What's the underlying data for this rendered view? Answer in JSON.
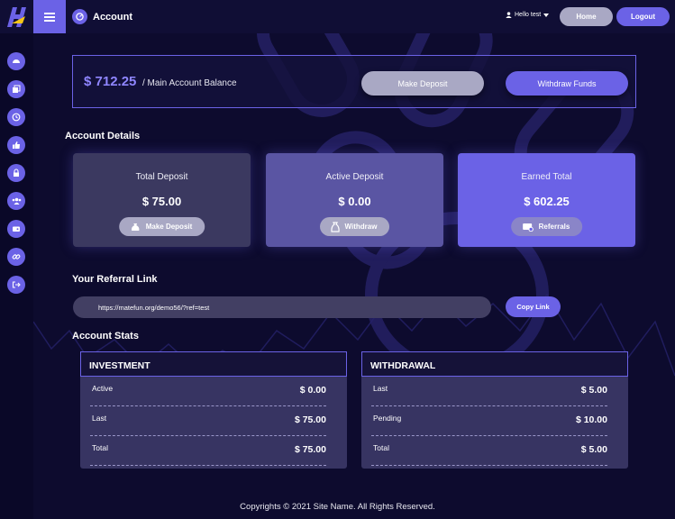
{
  "header": {
    "page_title": "Account",
    "user_greeting": "Hello test",
    "home_label": "Home",
    "logout_label": "Logout"
  },
  "sidebar": {
    "items": [
      {
        "icon": "dashboard-icon"
      },
      {
        "icon": "deposit-icon"
      },
      {
        "icon": "history-icon"
      },
      {
        "icon": "thumbs-up-icon"
      },
      {
        "icon": "lock-icon"
      },
      {
        "icon": "users-icon"
      },
      {
        "icon": "wallet-icon"
      },
      {
        "icon": "link-icon"
      },
      {
        "icon": "logout-icon"
      }
    ]
  },
  "balance": {
    "amount": "$ 712.25",
    "label": "/ Main Account Balance",
    "deposit_label": "Make Deposit",
    "withdraw_label": "Withdraw Funds"
  },
  "account_details": {
    "title": "Account Details",
    "cards": [
      {
        "label": "Total Deposit",
        "value": "$ 75.00",
        "button": "Make Deposit"
      },
      {
        "label": "Active Deposit",
        "value": "$ 0.00",
        "button": "Withdraw"
      },
      {
        "label": "Earned Total",
        "value": "$ 602.25",
        "button": "Referrals"
      }
    ]
  },
  "referral": {
    "title": "Your Referral Link",
    "link": "https://matefun.org/demo56/?ref=test",
    "copy_label": "Copy Link"
  },
  "stats": {
    "title": "Account Stats",
    "investment": {
      "header": "INVESTMENT",
      "rows": [
        {
          "label": "Active",
          "value": "$ 0.00"
        },
        {
          "label": "Last",
          "value": "$ 75.00"
        },
        {
          "label": "Total",
          "value": "$ 75.00"
        }
      ]
    },
    "withdrawal": {
      "header": "WITHDRAWAL",
      "rows": [
        {
          "label": "Last",
          "value": "$ 5.00"
        },
        {
          "label": "Pending",
          "value": "$ 10.00"
        },
        {
          "label": "Total",
          "value": "$ 5.00"
        }
      ]
    }
  },
  "footer": "Copyrights © 2021 Site Name. All Rights Reserved.",
  "colors": {
    "accent": "#6b62e6",
    "background": "#0d0b2e",
    "muted_button": "#a9a8c4",
    "balance_amount": "#8f86ff"
  }
}
